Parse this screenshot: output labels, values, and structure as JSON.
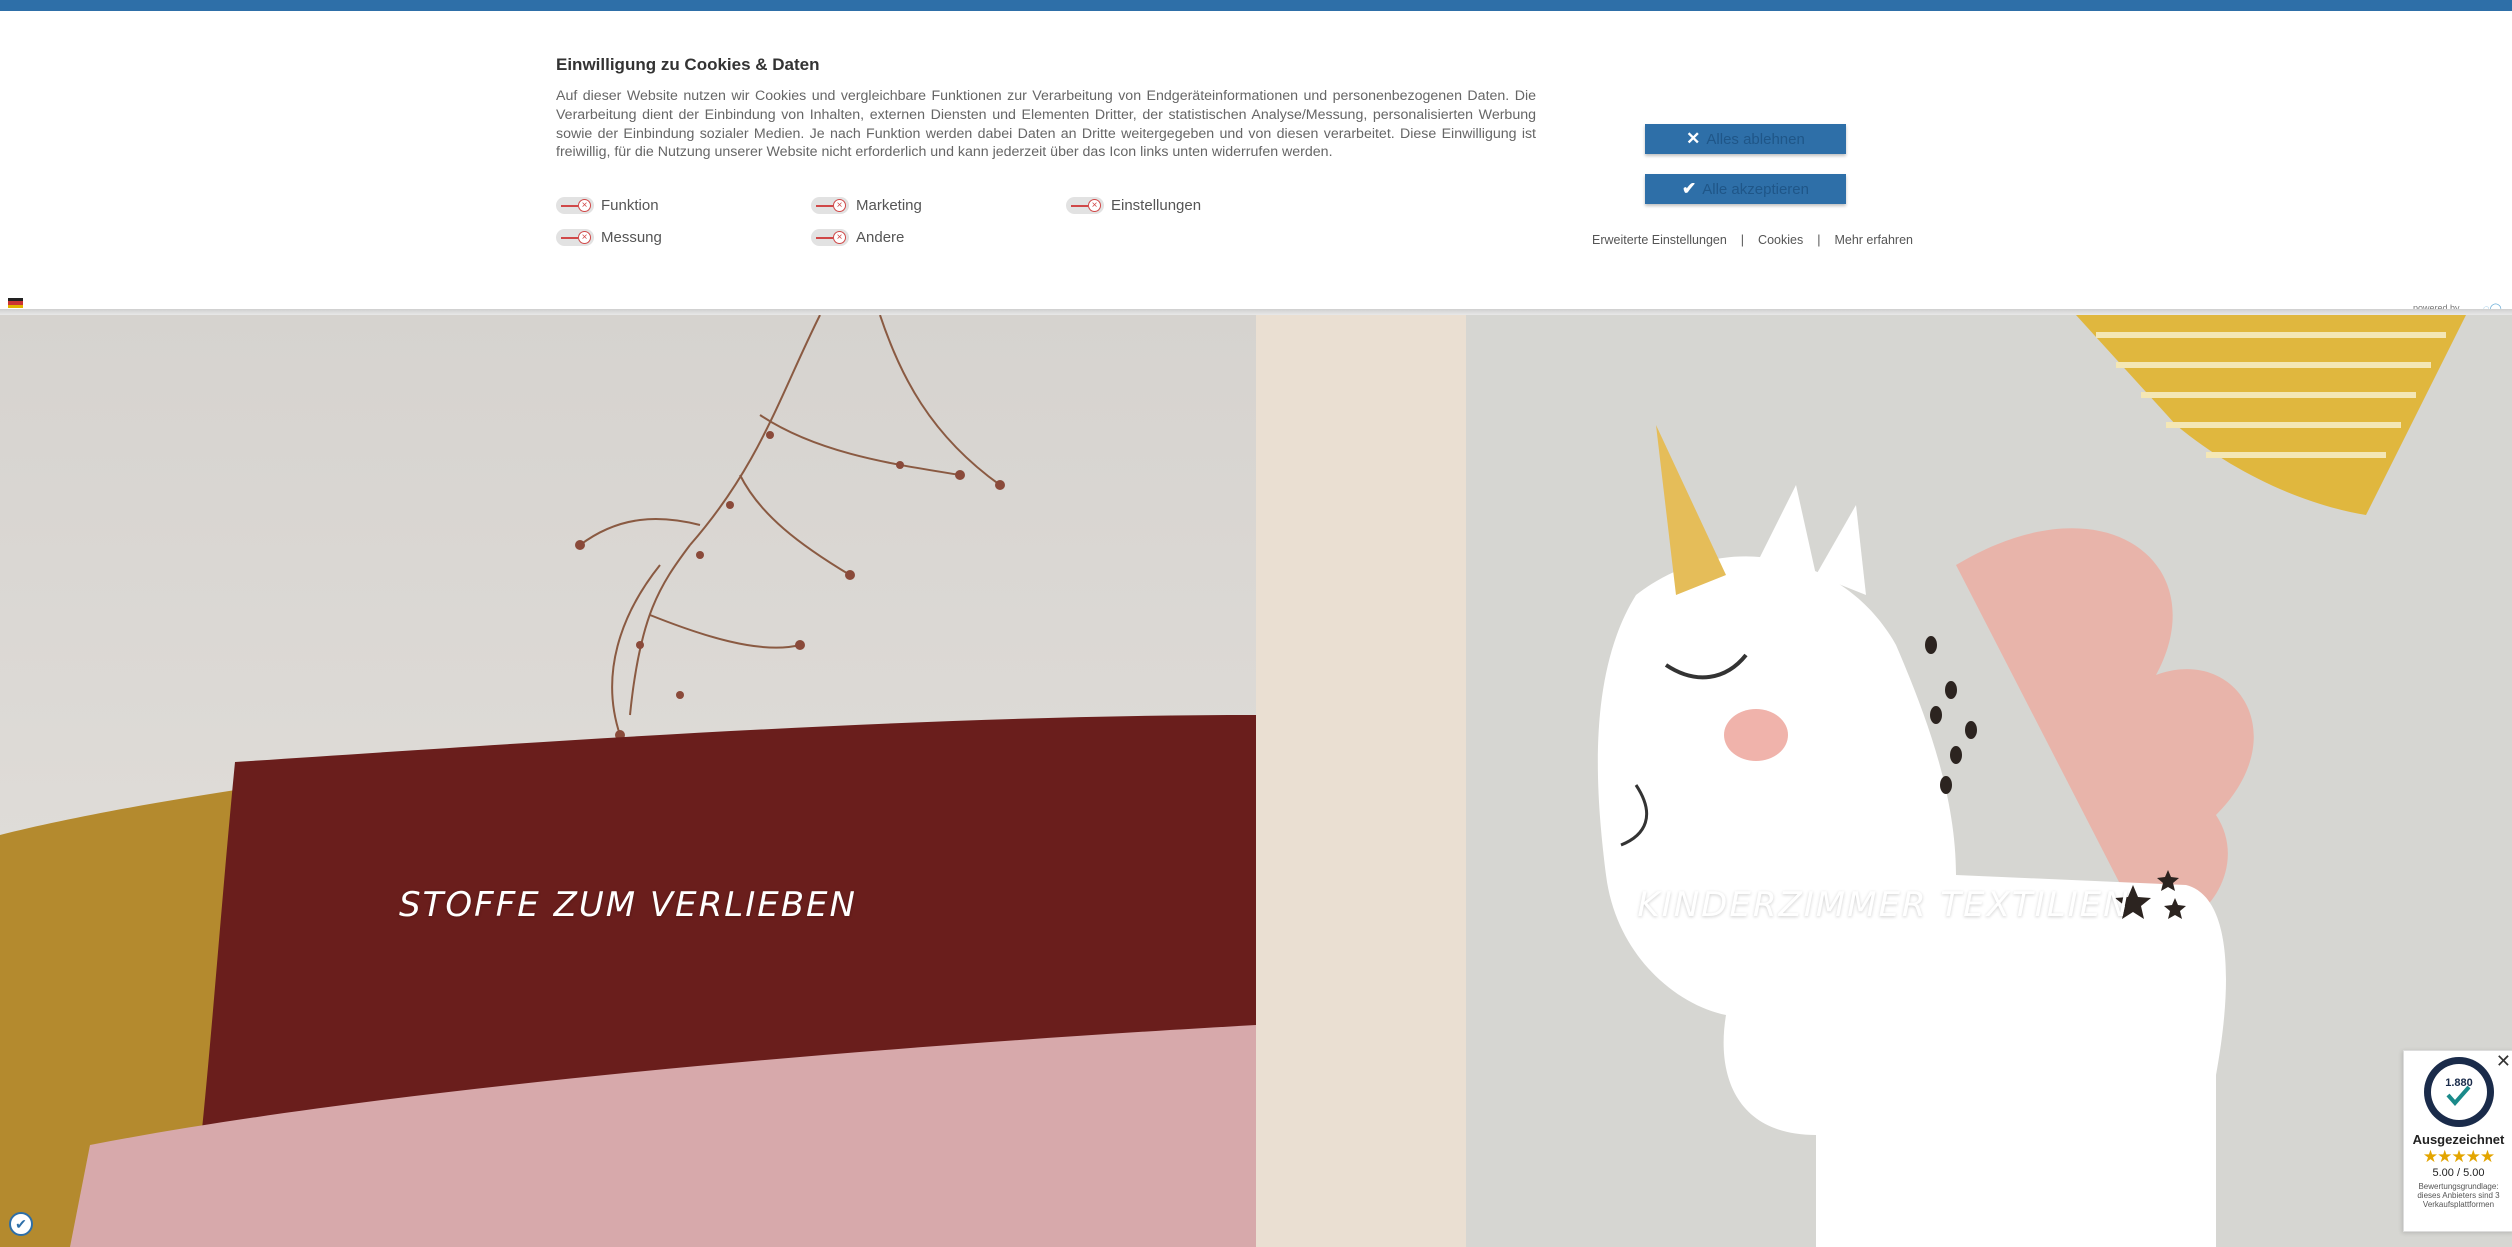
{
  "cookie_banner": {
    "title": "Einwilligung zu Cookies & Daten",
    "text": "Auf dieser Website nutzen wir Cookies und vergleichbare Funktionen zur Verarbeitung von Endgeräteinformationen und personenbezogenen Daten. Die Verarbeitung dient der Einbindung von Inhalten, externen Diensten und Elementen Dritter, der statistischen Analyse/Messung, personalisierten Werbung sowie der Einbindung sozialer Medien. Je nach Funktion werden dabei Daten an Dritte weitergegeben und von diesen verarbeitet. Diese Einwilligung ist freiwillig, für die Nutzung unserer Website nicht erforderlich und kann jederzeit über das Icon links unten widerrufen werden.",
    "toggles": [
      {
        "label": "Funktion",
        "enabled": false
      },
      {
        "label": "Marketing",
        "enabled": false
      },
      {
        "label": "Einstellungen",
        "enabled": false
      },
      {
        "label": "Messung",
        "enabled": false
      },
      {
        "label": "Andere",
        "enabled": false
      }
    ],
    "reject_label": "Alles ablehnen",
    "accept_label": "Alle akzeptieren",
    "links": [
      "Erweiterte Einstellungen",
      "Cookies",
      "Mehr erfahren"
    ],
    "separator": "|",
    "powered_by": "powered by",
    "accent_color": "#2e6fa8"
  },
  "hero": {
    "left_title": "STOFFE ZUM VERLIEBEN",
    "right_title": "KINDERZIMMER TEXTILIEN"
  },
  "trust_badge": {
    "seal_number": "1.880",
    "label": "Ausgezeichnet",
    "stars": "★★★★★",
    "score": "5.00 / 5.00",
    "note": "Bewertungsgrundlage: dieses Anbieters sind 3 Verkaufsplattformen"
  },
  "icons": {
    "reject": "close-icon",
    "accept": "check-icon",
    "language": "german-flag-icon",
    "privacy": "privacy-check-icon"
  }
}
